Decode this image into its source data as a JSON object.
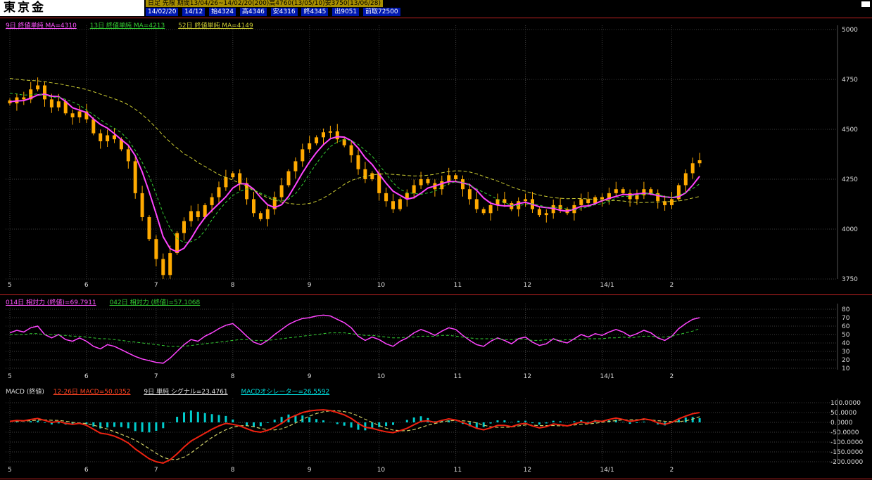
{
  "header": {
    "title": "東京金",
    "line1": "日足 先限 期間13/04/26~14/02/20(200)高4760(13/05/10)安3750(13/06/28)",
    "line2_items": [
      "14/02/20",
      "14/12",
      "始4324",
      "高4346",
      "安4316",
      "終4345",
      "出9051",
      "前取72500"
    ]
  },
  "legends": {
    "main": [
      {
        "label": "9日 終値単純 MA=4310",
        "color": "#ff55ff"
      },
      {
        "label": "13日 終値単純 MA=4213",
        "color": "#33cc33"
      },
      {
        "label": "52日 終値単純 MA=4149",
        "color": "#cccc33"
      }
    ],
    "rsi": [
      {
        "label": "014日 相対力 (終値)=69.7911",
        "color": "#ff55ff"
      },
      {
        "label": "042日 相対力 (終値)=57.1068",
        "color": "#33cc33"
      }
    ],
    "macd_title": {
      "label": "MACD (終値)",
      "color": "#dddddd"
    },
    "macd": [
      {
        "label": "12-26日 MACD=50.0352",
        "color": "#ff4422"
      },
      {
        "label": "9日 単純 シグナル=23.4761",
        "color": "#dddddd"
      },
      {
        "label": "MACDオシレーター=26.5592",
        "color": "#00dddd"
      }
    ]
  },
  "chart_data": [
    {
      "id": "price",
      "type": "candlestick",
      "title": "東京金 日足",
      "x_tick_labels": [
        "5",
        "6",
        "7",
        "8",
        "9",
        "10",
        "11",
        "12",
        "14/1",
        "2"
      ],
      "x_tick_indices": [
        0,
        11,
        21,
        32,
        43,
        53,
        64,
        74,
        85,
        95
      ],
      "y_ticks": [
        5000,
        4750,
        4500,
        4250,
        4000,
        3750
      ],
      "ylim": [
        3740,
        5045
      ],
      "period_high": 4760,
      "period_low": 3750,
      "last_close": 4345,
      "candle_color": "#ffaa00",
      "closes": [
        4630,
        4660,
        4650,
        4700,
        4720,
        4650,
        4610,
        4640,
        4580,
        4560,
        4590,
        4550,
        4480,
        4440,
        4470,
        4450,
        4400,
        4340,
        4180,
        4060,
        3950,
        3850,
        3770,
        3880,
        3980,
        4040,
        4090,
        4060,
        4120,
        4160,
        4210,
        4260,
        4280,
        4230,
        4150,
        4080,
        4050,
        4100,
        4160,
        4220,
        4290,
        4340,
        4400,
        4430,
        4460,
        4485,
        4490,
        4450,
        4420,
        4370,
        4300,
        4250,
        4280,
        4180,
        4140,
        4100,
        4150,
        4180,
        4220,
        4250,
        4230,
        4200,
        4240,
        4270,
        4250,
        4200,
        4150,
        4100,
        4080,
        4120,
        4150,
        4130,
        4100,
        4140,
        4150,
        4100,
        4070,
        4080,
        4120,
        4100,
        4080,
        4120,
        4150,
        4130,
        4160,
        4150,
        4180,
        4200,
        4180,
        4150,
        4170,
        4200,
        4180,
        4140,
        4120,
        4150,
        4220,
        4280,
        4330,
        4345
      ],
      "ma_lines": [
        {
          "name": "9日 終値単純",
          "period_days": 9,
          "legend_value": 4310,
          "color": "#ff44ff",
          "width": 2,
          "dash": "",
          "lead": 4640
        },
        {
          "name": "13日 終値単純",
          "period_days": 13,
          "legend_value": 4213,
          "color": "#33cc33",
          "width": 1,
          "dash": "4,3",
          "lead": 4690
        },
        {
          "name": "52日 終値単純",
          "period_days": 52,
          "legend_value": 4149,
          "color": "#cccc33",
          "width": 1,
          "dash": "5,3",
          "lead": 4760
        }
      ]
    },
    {
      "id": "rsi",
      "type": "line",
      "title": "相対力",
      "x_tick_labels": [
        "5",
        "6",
        "7",
        "8",
        "9",
        "10",
        "11",
        "12",
        "14/1",
        "2"
      ],
      "x_tick_indices": [
        0,
        11,
        21,
        32,
        43,
        53,
        64,
        74,
        85,
        95
      ],
      "y_ticks": [
        80,
        70,
        60,
        50,
        40,
        30,
        20,
        10
      ],
      "ylim": [
        5,
        88
      ],
      "series": [
        {
          "name": "014日 相対力 (終値)",
          "current": 69.7911,
          "color": "#ff44ff",
          "width": 1.5,
          "dash": "",
          "values": [
            52,
            55,
            53,
            58,
            60,
            50,
            46,
            50,
            44,
            42,
            46,
            42,
            36,
            33,
            38,
            36,
            32,
            28,
            24,
            21,
            19,
            17,
            16,
            22,
            30,
            38,
            44,
            42,
            48,
            52,
            57,
            61,
            63,
            56,
            48,
            41,
            38,
            43,
            50,
            56,
            62,
            66,
            69,
            70,
            72,
            73,
            72,
            68,
            64,
            58,
            48,
            43,
            47,
            44,
            39,
            36,
            42,
            46,
            52,
            56,
            53,
            49,
            54,
            58,
            56,
            49,
            43,
            38,
            36,
            42,
            46,
            43,
            39,
            45,
            47,
            41,
            37,
            39,
            45,
            42,
            40,
            45,
            50,
            47,
            51,
            49,
            53,
            56,
            53,
            48,
            51,
            55,
            52,
            46,
            43,
            48,
            57,
            63,
            68,
            70
          ]
        },
        {
          "name": "042日 相対力 (終値)",
          "current": 57.1068,
          "color": "#33cc33",
          "width": 1,
          "dash": "4,3",
          "values": [
            50,
            50,
            50,
            51,
            51,
            50,
            50,
            49,
            49,
            48,
            48,
            47,
            46,
            45,
            45,
            44,
            43,
            42,
            41,
            40,
            39,
            38,
            37,
            36,
            36,
            36,
            37,
            38,
            39,
            40,
            41,
            42,
            43,
            44,
            44,
            43,
            43,
            43,
            44,
            45,
            46,
            47,
            48,
            49,
            50,
            51,
            52,
            52,
            52,
            51,
            50,
            49,
            49,
            48,
            47,
            46,
            46,
            47,
            47,
            48,
            48,
            48,
            49,
            49,
            48,
            47,
            46,
            45,
            45,
            45,
            45,
            44,
            44,
            45,
            44,
            43,
            43,
            44,
            44,
            43,
            44,
            44,
            44,
            45,
            45,
            45,
            46,
            46,
            47,
            46,
            47,
            48,
            48,
            47,
            47,
            48,
            50,
            52,
            54,
            57
          ]
        }
      ]
    },
    {
      "id": "macd",
      "type": "macd",
      "title": "MACD (終値)",
      "x_tick_labels": [
        "5",
        "6",
        "7",
        "8",
        "9",
        "10",
        "11",
        "12",
        "14/1",
        "2"
      ],
      "x_tick_indices": [
        0,
        11,
        21,
        32,
        43,
        53,
        64,
        74,
        85,
        95
      ],
      "y_ticks": [
        100,
        50,
        0,
        -50,
        -100,
        -150,
        -200
      ],
      "y_tick_labels": [
        "100.0000",
        "50.0000",
        "0.0000",
        "-50.0000",
        "-100.0000",
        "-150.0000",
        "-200.0000"
      ],
      "ylim": [
        -215,
        115
      ],
      "ema_periods": "12-26日",
      "signal_period_days": 9,
      "macd_current": 50.0352,
      "signal_current": 23.4761,
      "oscillator_current": 26.5592,
      "macd_color": "#ee2211",
      "signal_color": "#cccc66",
      "hist_color": "#00cccc",
      "macd_values": [
        5,
        10,
        8,
        15,
        20,
        10,
        0,
        5,
        -5,
        -10,
        -5,
        -15,
        -35,
        -55,
        -60,
        -70,
        -85,
        -105,
        -135,
        -160,
        -185,
        -200,
        -207,
        -190,
        -160,
        -125,
        -95,
        -75,
        -55,
        -35,
        -18,
        -5,
        -10,
        -18,
        -32,
        -45,
        -50,
        -40,
        -25,
        -5,
        20,
        35,
        50,
        58,
        62,
        64,
        60,
        50,
        38,
        20,
        -5,
        -25,
        -30,
        -40,
        -48,
        -52,
        -42,
        -30,
        -12,
        5,
        8,
        0,
        10,
        18,
        12,
        0,
        -15,
        -30,
        -38,
        -28,
        -15,
        -15,
        -22,
        -10,
        -5,
        -18,
        -28,
        -22,
        -8,
        -12,
        -18,
        -8,
        2,
        -5,
        8,
        5,
        15,
        22,
        15,
        5,
        10,
        18,
        12,
        -2,
        -10,
        0,
        18,
        32,
        44,
        50
      ]
    }
  ]
}
